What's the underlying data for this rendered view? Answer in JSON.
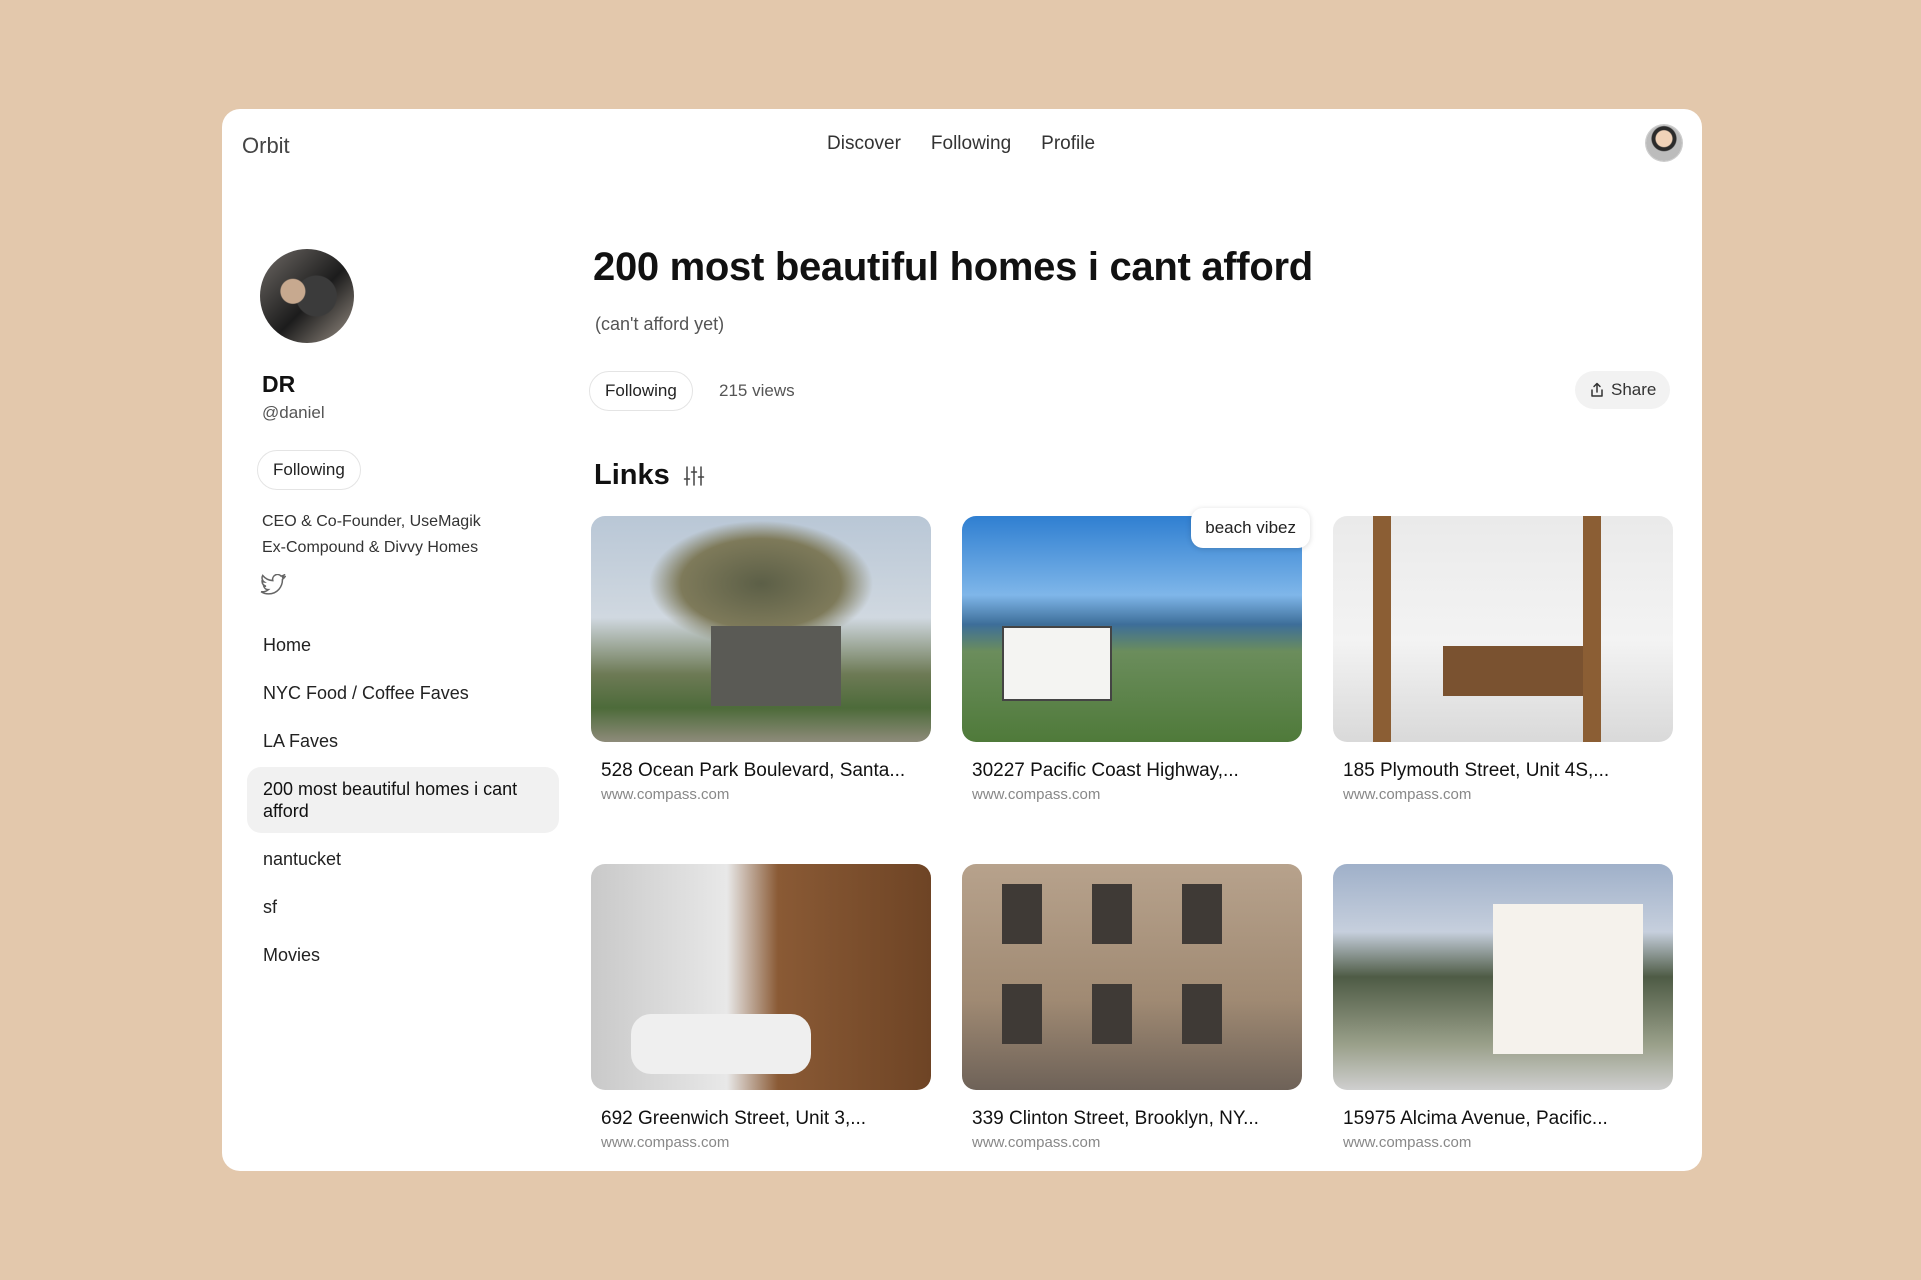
{
  "app": {
    "brand": "Orbit",
    "nav": [
      "Discover",
      "Following",
      "Profile"
    ]
  },
  "profile": {
    "name": "DR",
    "handle": "@daniel",
    "follow_label": "Following",
    "bio": [
      "CEO & Co-Founder, UseMagik",
      "Ex-Compound & Divvy Homes"
    ]
  },
  "sidebar": {
    "items": [
      {
        "label": "Home"
      },
      {
        "label": "NYC Food / Coffee Faves"
      },
      {
        "label": "LA Faves"
      },
      {
        "label": "200 most beautiful homes i cant afford",
        "active": true
      },
      {
        "label": "nantucket"
      },
      {
        "label": "sf"
      },
      {
        "label": "Movies"
      }
    ]
  },
  "collection": {
    "title": "200 most beautiful homes i cant afford",
    "subtitle": "(can't afford yet)",
    "follow_label": "Following",
    "views": "215 views",
    "share_label": "Share",
    "links_heading": "Links"
  },
  "cards": [
    {
      "title": "528 Ocean Park Boulevard, Santa...",
      "domain": "www.compass.com"
    },
    {
      "title": "30227 Pacific Coast Highway,...",
      "domain": "www.compass.com",
      "tag": "beach vibez"
    },
    {
      "title": "185 Plymouth Street, Unit 4S,...",
      "domain": "www.compass.com"
    },
    {
      "title": "692 Greenwich Street, Unit 3,...",
      "domain": "www.compass.com"
    },
    {
      "title": "339 Clinton Street, Brooklyn, NY...",
      "domain": "www.compass.com"
    },
    {
      "title": "15975 Alcima Avenue, Pacific...",
      "domain": "www.compass.com"
    }
  ],
  "colors": {
    "background": "#E3C8AC",
    "panel": "#FFFFFF",
    "active_item": "#F1F1F1"
  },
  "icons": [
    "twitter-icon",
    "share-icon",
    "filter-icon",
    "avatar"
  ]
}
